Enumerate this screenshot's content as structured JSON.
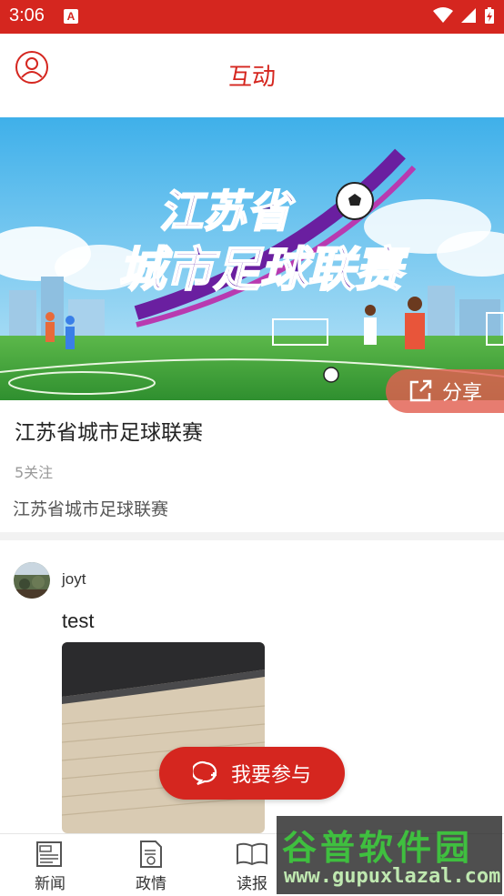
{
  "status_bar": {
    "time": "3:06",
    "notification_letter": "A",
    "bg_color": "#d5261f"
  },
  "header": {
    "title": "互动",
    "accent_color": "#d5261f",
    "left_icon": "user-profile-icon"
  },
  "banner": {
    "headline_line1": "江苏省",
    "headline_line2": "城市足球联赛",
    "share_label": "分享",
    "share_icon": "external-share-icon"
  },
  "topic": {
    "title": "江苏省城市足球联赛",
    "followers": "5关注",
    "description": "江苏省城市足球联赛"
  },
  "post": {
    "username": "joyt",
    "text": "test"
  },
  "join_button": {
    "label": "我要参与",
    "icon": "chat-plus-icon"
  },
  "bottom_nav": {
    "items": [
      {
        "label": "新闻",
        "icon": "newspaper-icon"
      },
      {
        "label": "政情",
        "icon": "document-icon"
      },
      {
        "label": "读报",
        "icon": "open-book-icon"
      }
    ]
  },
  "watermark": {
    "title": "谷普软件园",
    "url": "www.gupuxlazal.com"
  }
}
